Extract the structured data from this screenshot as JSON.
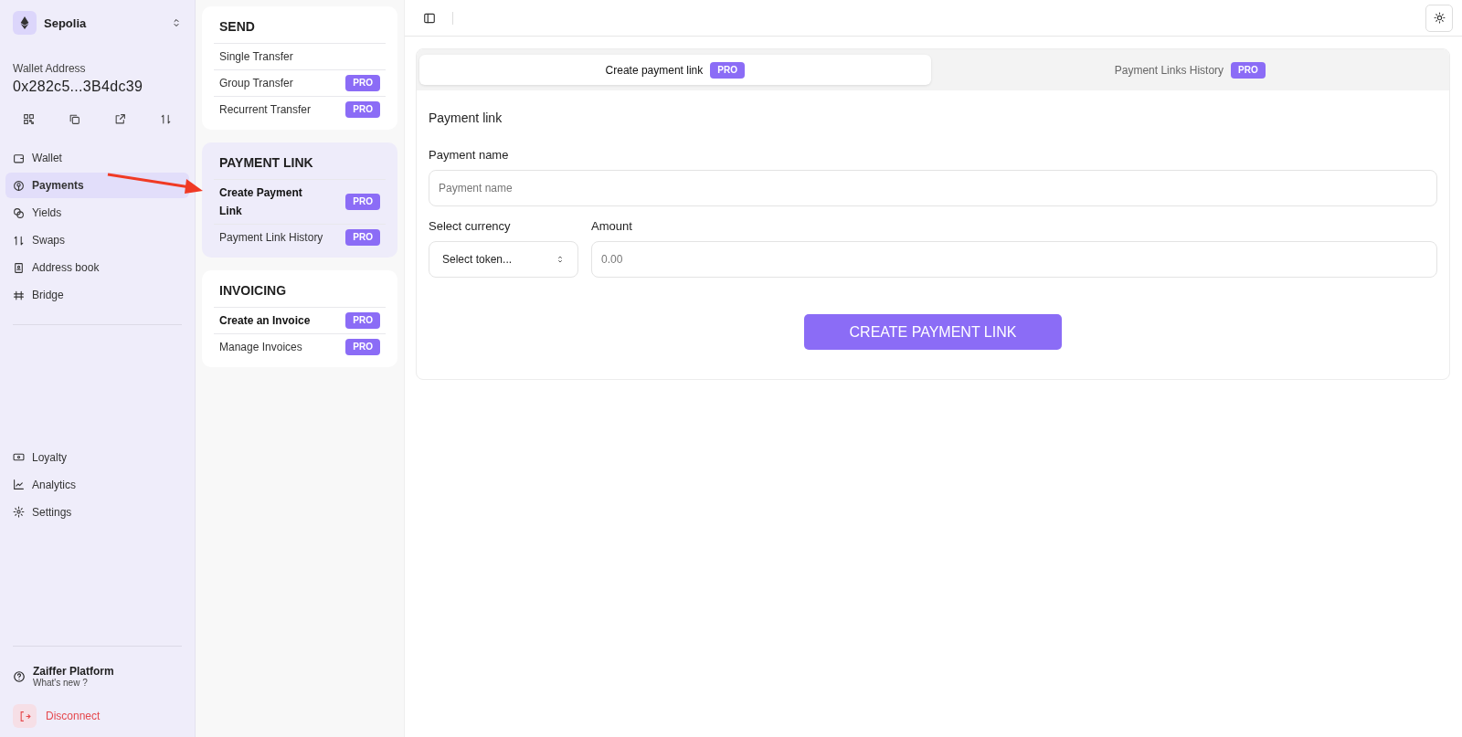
{
  "network": {
    "name": "Sepolia"
  },
  "wallet": {
    "label": "Wallet Address",
    "address": "0x282c5...3B4dc39"
  },
  "nav": [
    {
      "label": "Wallet",
      "selected": false
    },
    {
      "label": "Payments",
      "selected": true
    },
    {
      "label": "Yields",
      "selected": false
    },
    {
      "label": "Swaps",
      "selected": false
    },
    {
      "label": "Address book",
      "selected": false
    },
    {
      "label": "Bridge",
      "selected": false
    }
  ],
  "nav_lower": [
    {
      "label": "Loyalty",
      "selected": false
    },
    {
      "label": "Analytics",
      "selected": false
    },
    {
      "label": "Settings",
      "selected": false
    }
  ],
  "platform": {
    "title": "Zaiffer Platform",
    "subtitle": "What's new ?"
  },
  "disconnect": "Disconnect",
  "sections": [
    {
      "title": "SEND",
      "selected": false,
      "items": [
        {
          "label": "Single Transfer",
          "selected": false
        },
        {
          "label": "Group Transfer",
          "badge": "PRO",
          "selected": false
        },
        {
          "label": "Recurrent Transfer",
          "badge": "PRO",
          "selected": false
        }
      ]
    },
    {
      "title": "PAYMENT LINK",
      "selected": true,
      "items": [
        {
          "label": "Create Payment Link",
          "badge": "PRO",
          "selected": true
        },
        {
          "label": "Payment Link History",
          "badge": "PRO",
          "selected": false
        }
      ]
    },
    {
      "title": "INVOICING",
      "selected": false,
      "items": [
        {
          "label": "Create an Invoice",
          "badge": "PRO",
          "selected": true
        },
        {
          "label": "Manage Invoices",
          "badge": "PRO",
          "selected": false
        }
      ]
    }
  ],
  "tabs": [
    {
      "label": "Create payment link",
      "badge": "PRO",
      "selected": true
    },
    {
      "label": "Payment Links History",
      "badge": "PRO",
      "selected": false
    }
  ],
  "form": {
    "title": "Payment link",
    "name_label": "Payment name",
    "name_placeholder": "Payment name",
    "currency_label": "Select currency",
    "currency_placeholder": "Select token...",
    "amount_label": "Amount",
    "amount_placeholder": "0.00",
    "submit": "CREATE PAYMENT LINK"
  }
}
